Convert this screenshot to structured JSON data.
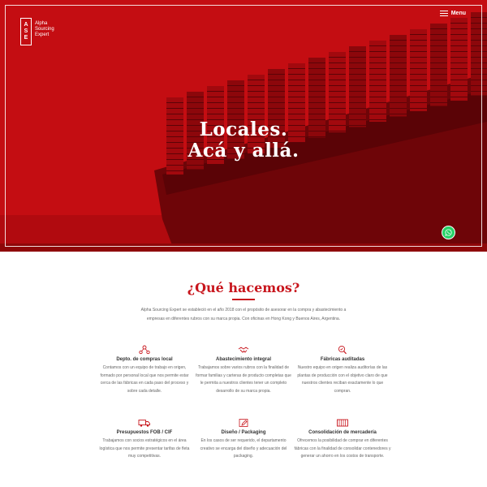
{
  "header": {
    "logo_mark": [
      "A",
      "S",
      "E"
    ],
    "logo_text": [
      "Alpha",
      "Sourcing",
      "Expert"
    ],
    "menu_label": "Menu"
  },
  "hero": {
    "line1": "Locales.",
    "line2": "Acá y allá.",
    "overlay_color": "#c40d12"
  },
  "section": {
    "title": "¿Qué hacemos?",
    "intro": "Alpha Sourcing Expert se estableció en el año 2018 con el propósito de asesorar en la compra y abastecimiento a empresas en diferentes rubros con su marca propia. Con oficinas en Hong Kong y Buenos Aires, Argentina.",
    "accent_color": "#c8161d"
  },
  "services": [
    {
      "icon": "network-icon",
      "title": "Depto. de compras local",
      "text": "Contamos con un equipo de trabajo en origen, formado por personal local que nos permite estar cerca de las fábricas en cada paso del proceso y sobre cada detalle."
    },
    {
      "icon": "handshake-icon",
      "title": "Abastecimiento integral",
      "text": "Trabajamos sobre varios rubros con la finalidad de formar familias y carteras de producto completas que le permita a nuestros clientes tener un completo desarrollo de su marca propia."
    },
    {
      "icon": "magnifier-icon",
      "title": "Fábricas auditadas",
      "text": "Nuestro equipo en origen realiza auditorías de las plantas de producción con el objetivo claro de que nuestros clientes reciban exactamente lo que compran."
    },
    {
      "icon": "truck-icon",
      "title": "Presupuestos FOB / CIF",
      "text": "Trabajamos con socios estratégicos en el área logística que nos permite presentar tarifas de fleta muy competitivas."
    },
    {
      "icon": "pencil-icon",
      "title": "Diseño / Packaging",
      "text": "En los casos de ser requerido, el departamento creativo se encarga del diseño y adecuación del packaging."
    },
    {
      "icon": "container-icon",
      "title": "Consolidación de mercadería",
      "text": "Ofrecemos la posibilidad de comprar en diferentes fábricas con la finalidad de consolidar contenedores y generar un ahorro en los costos de transporte."
    }
  ]
}
